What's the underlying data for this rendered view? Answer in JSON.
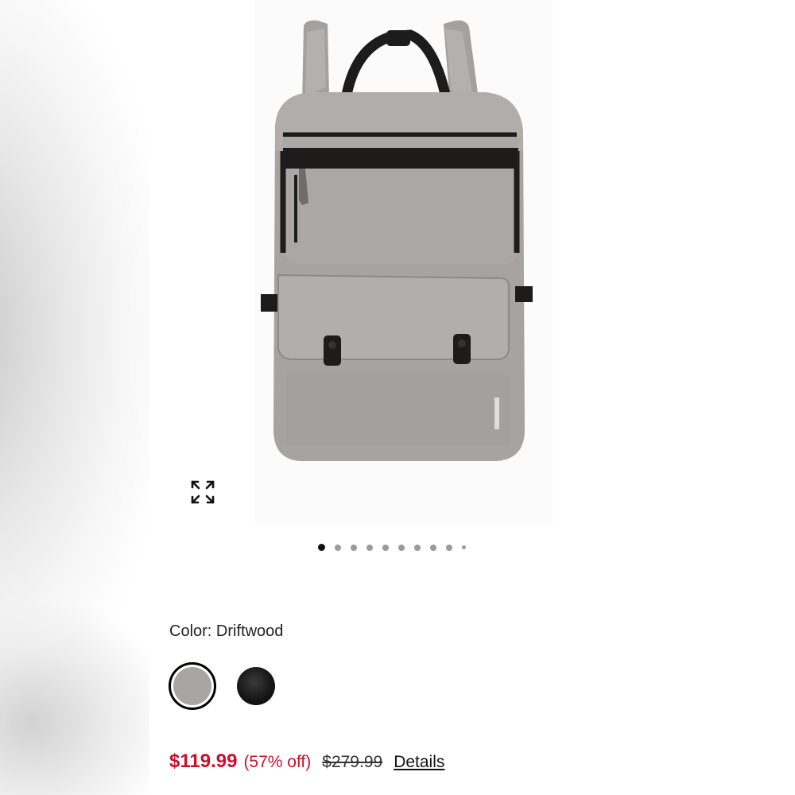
{
  "product": {
    "color_label": "Color: Driftwood",
    "colors": [
      {
        "name": "Driftwood",
        "hex": "#a8a6a4",
        "selected": true
      },
      {
        "name": "Black",
        "hex": "#141414",
        "selected": false
      }
    ],
    "price": {
      "sale": "$119.99",
      "discount": "(57% off)",
      "original": "$279.99",
      "sale_color": "#c8102e"
    },
    "details_link": "Details"
  },
  "gallery": {
    "image_count": 10,
    "active_index": 0,
    "expand_icon": "expand-arrows-icon"
  }
}
